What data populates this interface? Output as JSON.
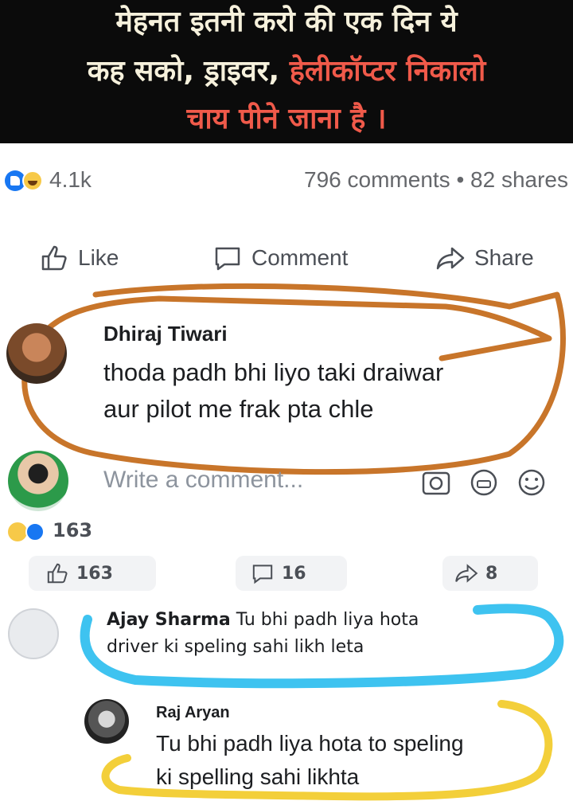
{
  "banner": {
    "line1": "मेहनत इतनी करो की एक दिन ये",
    "line2a": "कह सको, ड्राइवर,",
    "line2b": "हेलीकॉप्टर निकालो",
    "line3": "चाय पीने जाना है ।"
  },
  "post_stats": {
    "reactions_count": "4.1k",
    "comments_shares": "796 comments • 82 shares"
  },
  "post_actions": {
    "like": "Like",
    "comment": "Comment",
    "share": "Share"
  },
  "comment1": {
    "author": "Dhiraj Tiwari",
    "text_line1": "thoda padh bhi liyo taki draiwar",
    "text_line2": "aur pilot me frak pta chle"
  },
  "composer": {
    "placeholder": "Write a comment..."
  },
  "comment_meta": {
    "reactions_count": "163",
    "likes": "163",
    "replies": "16",
    "shares": "8"
  },
  "reply1": {
    "author": "Ajay Sharma",
    "text_line1": "Tu bhi padh liya hota",
    "text_line2": "driver ki speling sahi likh leta"
  },
  "reply2": {
    "author": "Raj Aryan",
    "text_line1": "Tu bhi padh liya hota to speling",
    "text_line2": "ki spelling sahi likhta"
  },
  "colors": {
    "banner_bg": "#0b0b0b",
    "banner_red": "#f05a4a",
    "facebook_blue": "#1877f2",
    "orange_marker": "#c8752a",
    "blue_marker": "#3ec3f0",
    "yellow_marker": "#f3cf3a"
  }
}
